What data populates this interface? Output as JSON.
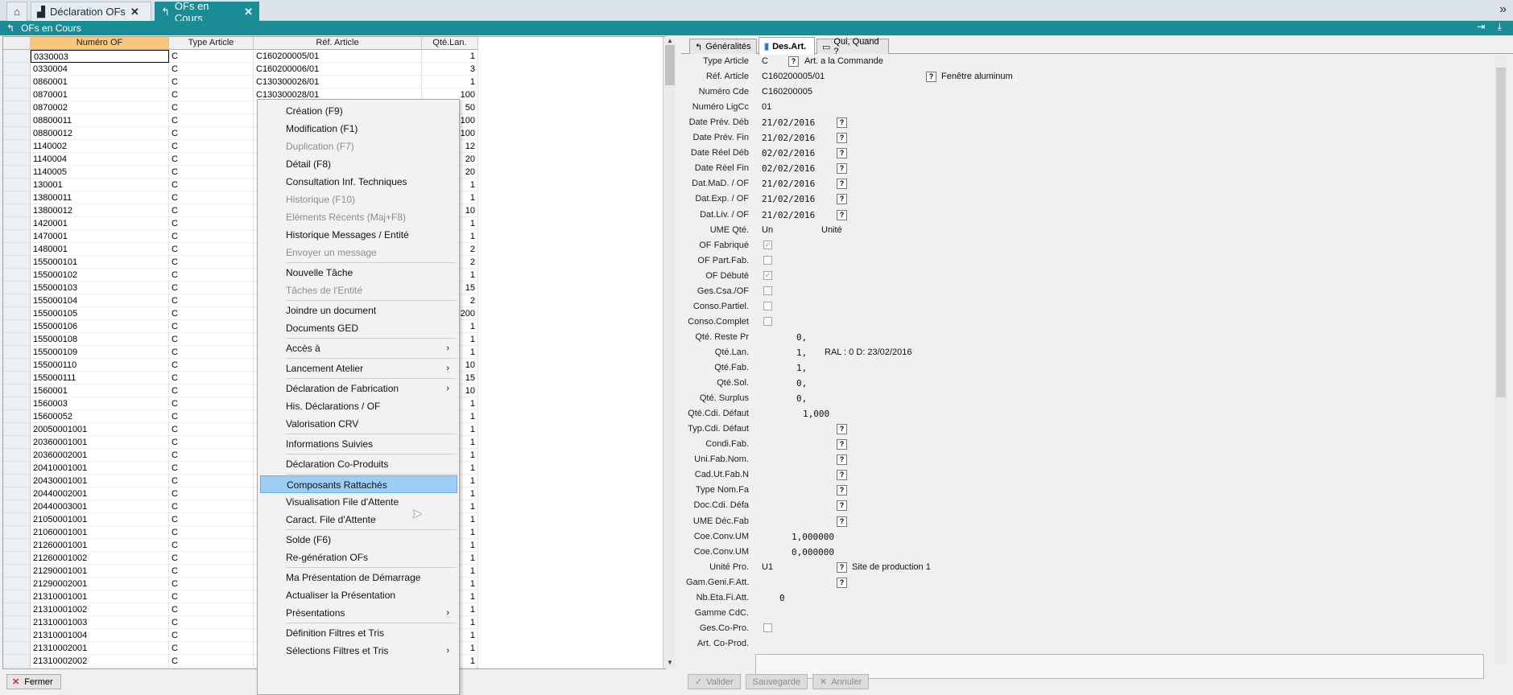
{
  "tabs": [
    {
      "label": "Déclaration OFs",
      "close": "✕",
      "active": false
    },
    {
      "label": "OFs en Cours",
      "close": "✕",
      "active": true
    }
  ],
  "subheader": {
    "title": "OFs en Cours",
    "right_icons": "⇥ ⤓"
  },
  "grid": {
    "columns": [
      "Numéro OF",
      "Type Article",
      "Réf. Article",
      "Qté.Lan."
    ],
    "rows": [
      [
        "0330003",
        "C",
        "C160200005/01",
        "1"
      ],
      [
        "0330004",
        "C",
        "C160200006/01",
        "3"
      ],
      [
        "0860001",
        "C",
        "C130300026/01",
        "1"
      ],
      [
        "0870001",
        "C",
        "C130300028/01",
        "100"
      ],
      [
        "0870002",
        "C",
        "",
        "50"
      ],
      [
        "08800011",
        "C",
        "",
        "100"
      ],
      [
        "08800012",
        "C",
        "",
        "100"
      ],
      [
        "1140002",
        "C",
        "",
        "12"
      ],
      [
        "1140004",
        "C",
        "",
        "20"
      ],
      [
        "1140005",
        "C",
        "",
        "20"
      ],
      [
        "130001",
        "C",
        "",
        "1"
      ],
      [
        "13800011",
        "C",
        "",
        "1"
      ],
      [
        "13800012",
        "C",
        "",
        "10"
      ],
      [
        "1420001",
        "C",
        "",
        "1"
      ],
      [
        "1470001",
        "C",
        "",
        "1"
      ],
      [
        "1480001",
        "C",
        "",
        "2"
      ],
      [
        "155000101",
        "C",
        "",
        "2"
      ],
      [
        "155000102",
        "C",
        "",
        "1"
      ],
      [
        "155000103",
        "C",
        "",
        "15"
      ],
      [
        "155000104",
        "C",
        "",
        "2"
      ],
      [
        "155000105",
        "C",
        "",
        "200"
      ],
      [
        "155000106",
        "C",
        "",
        "1"
      ],
      [
        "155000108",
        "C",
        "",
        "1"
      ],
      [
        "155000109",
        "C",
        "",
        "1"
      ],
      [
        "155000110",
        "C",
        "",
        "10"
      ],
      [
        "155000111",
        "C",
        "",
        "15"
      ],
      [
        "1560001",
        "C",
        "",
        "10"
      ],
      [
        "1560003",
        "C",
        "",
        "1"
      ],
      [
        "15600052",
        "C",
        "",
        "1"
      ],
      [
        "20050001001",
        "C",
        "",
        "1"
      ],
      [
        "20360001001",
        "C",
        "",
        "1"
      ],
      [
        "20360002001",
        "C",
        "",
        "1"
      ],
      [
        "20410001001",
        "C",
        "",
        "1"
      ],
      [
        "20430001001",
        "C",
        "",
        "1"
      ],
      [
        "20440002001",
        "C",
        "",
        "1"
      ],
      [
        "20440003001",
        "C",
        "",
        "1"
      ],
      [
        "21050001001",
        "C",
        "",
        "1"
      ],
      [
        "21060001001",
        "C",
        "",
        "1"
      ],
      [
        "21260001001",
        "C",
        "",
        "1"
      ],
      [
        "21260001002",
        "C",
        "",
        "1"
      ],
      [
        "21290001001",
        "C",
        "",
        "1"
      ],
      [
        "21290002001",
        "C",
        "",
        "1"
      ],
      [
        "21310001001",
        "C",
        "",
        "1"
      ],
      [
        "21310001002",
        "C",
        "",
        "1"
      ],
      [
        "21310001003",
        "C",
        "",
        "1"
      ],
      [
        "21310001004",
        "C",
        "",
        "1"
      ],
      [
        "21310002001",
        "C",
        "",
        "1"
      ],
      [
        "21310002002",
        "C",
        "",
        "1"
      ]
    ]
  },
  "close_button": {
    "label": "Fermer",
    "icon": "✕"
  },
  "menu": [
    {
      "label": "Création (F9)",
      "disabled": false
    },
    {
      "label": "Modification (F1)",
      "disabled": false
    },
    {
      "label": "Duplication (F7)",
      "disabled": true
    },
    {
      "label": "Détail (F8)",
      "disabled": false
    },
    {
      "label": "Consultation Inf. Techniques",
      "disabled": false
    },
    {
      "label": "Historique (F10)",
      "disabled": true
    },
    {
      "label": "Eléments Récents (Maj+F8)",
      "disabled": true
    },
    {
      "label": "Historique Messages / Entité",
      "disabled": false
    },
    {
      "label": "Envoyer un message",
      "disabled": true
    },
    {
      "sep": true
    },
    {
      "label": "Nouvelle Tâche",
      "disabled": false
    },
    {
      "label": "Tâches de l'Entité",
      "disabled": true
    },
    {
      "sep": true
    },
    {
      "label": "Joindre un document",
      "disabled": false
    },
    {
      "label": "Documents GED",
      "disabled": false
    },
    {
      "sep": true
    },
    {
      "label": "Accès à",
      "submenu": true
    },
    {
      "sep": true
    },
    {
      "label": "Lancement Atelier",
      "submenu": true
    },
    {
      "sep": true
    },
    {
      "label": "Déclaration de Fabrication",
      "submenu": true
    },
    {
      "label": "His. Déclarations / OF"
    },
    {
      "label": "Valorisation CRV"
    },
    {
      "sep": true
    },
    {
      "label": "Informations Suivies"
    },
    {
      "sep": true
    },
    {
      "label": "Déclaration Co-Produits"
    },
    {
      "sep": true
    },
    {
      "label": "Composants Rattachés",
      "highlighted": true
    },
    {
      "label": "Visualisation File d'Attente"
    },
    {
      "label": "Caract. File d'Attente"
    },
    {
      "sep": true
    },
    {
      "label": "Solde (F6)"
    },
    {
      "label": "Re-génération OFs"
    },
    {
      "sep": true
    },
    {
      "label": "Ma Présentation de Démarrage"
    },
    {
      "label": "Actualiser la Présentation"
    },
    {
      "label": "Présentations",
      "submenu": true
    },
    {
      "sep": true
    },
    {
      "label": "Définition Filtres et Tris"
    },
    {
      "label": "Sélections Filtres et Tris",
      "submenu": true
    }
  ],
  "right_tabs": [
    {
      "label": "Généralités"
    },
    {
      "label": "Des.Art.",
      "active": true
    },
    {
      "label": "Qui, Quand ?"
    }
  ],
  "form": [
    {
      "label": "Type Article",
      "value": "C",
      "q": true,
      "extra": "Art. a la Commande"
    },
    {
      "label": "Réf. Article",
      "value": "C160200005/01",
      "q2": true,
      "extra2": "Fenêtre aluminum"
    },
    {
      "label": "Numéro Cde",
      "value": "C160200005"
    },
    {
      "label": "Numéro LigCc",
      "value": "01"
    },
    {
      "label": "Date Prév. Déb",
      "value": "21/02/2016",
      "mono": true,
      "qr": true
    },
    {
      "label": "Date Prév. Fin",
      "value": "21/02/2016",
      "mono": true,
      "qr": true
    },
    {
      "label": "Date Réel Déb",
      "value": "02/02/2016",
      "mono": true,
      "qr": true
    },
    {
      "label": "Date Réel Fin",
      "value": "02/02/2016",
      "mono": true,
      "qr": true
    },
    {
      "label": "Dat.MaD. / OF",
      "value": "21/02/2016",
      "mono": true,
      "qr": true
    },
    {
      "label": "Dat.Exp. / OF",
      "value": "21/02/2016",
      "mono": true,
      "qr": true
    },
    {
      "label": "Dat.Liv. / OF",
      "value": "21/02/2016",
      "mono": true,
      "qr": true
    },
    {
      "label": "UME Qté.",
      "value": "Un",
      "extra3": "Unité"
    },
    {
      "label": "OF Fabriqué",
      "cb": "✓"
    },
    {
      "label": "OF Part.Fab.",
      "cb": ""
    },
    {
      "label": "OF Débuté",
      "cb": "✓"
    },
    {
      "label": "Ges.Csa./OF",
      "cb": ""
    },
    {
      "label": "Conso.Partiel.",
      "cb": ""
    },
    {
      "label": "Conso.Complet",
      "cb": ""
    },
    {
      "label": "Qté. Reste Pr",
      "numval": "0,",
      "mono": true
    },
    {
      "label": "Qté.Lan.",
      "numval": "1,",
      "mono": true,
      "extra4": "RAL : 0 D: 23/02/2016"
    },
    {
      "label": "Qté.Fab.",
      "numval": "1,",
      "mono": true
    },
    {
      "label": "Qté.Sol.",
      "numval": "0,",
      "mono": true
    },
    {
      "label": "Qté. Surplus",
      "numval": "0,",
      "mono": true
    },
    {
      "label": "Qté.Cdi. Défaut",
      "numval2": "1,000",
      "mono": true
    },
    {
      "label": "Typ.Cdi. Défaut",
      "qr": true
    },
    {
      "label": "Condi.Fab.",
      "qr": true
    },
    {
      "label": "Uni.Fab.Nom.",
      "qr": true
    },
    {
      "label": "Cad.Ut.Fab.N",
      "qr": true
    },
    {
      "label": "Type Nom.Fa",
      "qr": true
    },
    {
      "label": "Doc.Cdi. Défa",
      "qr": true
    },
    {
      "label": "UME Déc.Fab",
      "qr": true
    },
    {
      "label": "Coe.Conv.UM",
      "numval3": "1,000000",
      "mono": true
    },
    {
      "label": "Coe.Conv.UM",
      "numval3": "0,000000",
      "mono": true
    },
    {
      "label": "Unité Pro.",
      "value": "U1",
      "qr": true,
      "extra5": "Site de production 1"
    },
    {
      "label": "Gam.Geni.F.Att.",
      "qr": true
    },
    {
      "label": "Nb.Eta.Fi.Att.",
      "numval4": "0",
      "mono": true
    },
    {
      "label": "Gamme CdC.",
      "value": ""
    },
    {
      "label": "Ges.Co-Pro.",
      "cb": ""
    },
    {
      "label": "Art. Co-Prod.",
      "value": ""
    }
  ],
  "bottom_buttons": [
    {
      "label": "Valider",
      "icon": "✓"
    },
    {
      "label": "Sauvegarde",
      "icon": ""
    },
    {
      "label": "Annuler",
      "icon": "✕"
    }
  ],
  "colors": {
    "teal": "#1a8c96",
    "highlight": "#9ccdf5",
    "header_selected": "#f7c87a"
  }
}
